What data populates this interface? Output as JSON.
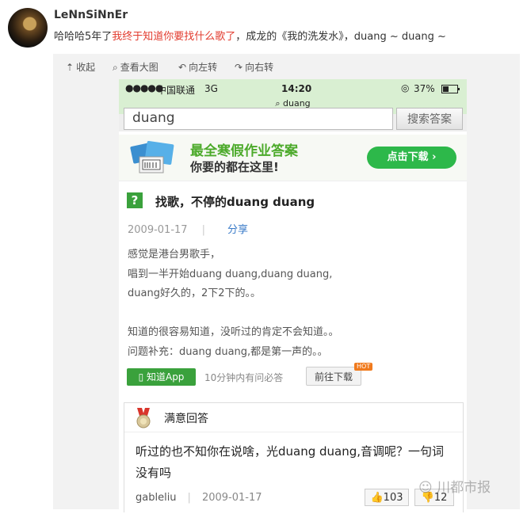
{
  "post": {
    "username": "LeNnSiNnEr",
    "text_before": "哈哈哈5年了",
    "text_highlight": "我终于知道你要找什么歌了",
    "text_after": "，成龙的《我的洗发水》，duang ~ duang ~"
  },
  "toolbar": {
    "collapse": "收起",
    "view_large": "查看大图",
    "rotate_left": "向左转",
    "rotate_right": "向右转"
  },
  "phone": {
    "status": {
      "signal": "●●●●●",
      "carrier": "中国联通",
      "network": "3G",
      "time": "14:20",
      "battery": "37%",
      "url": "duang"
    },
    "search": {
      "query": "duang",
      "button": "搜索答案"
    },
    "banner": {
      "line1": "最全寒假作业答案",
      "line2": "你要的都在这里!",
      "download": "点击下载 ›"
    },
    "question": {
      "icon": "?",
      "title": "找歌，不停的duang duang",
      "date": "2009-01-17",
      "share": "分享",
      "lines": [
        "感觉是港台男歌手，",
        "唱到一半开始duang duang,duang duang,",
        "duang好久的，2下2下的。。",
        "",
        "知道的很容易知道，没听过的肯定不会知道。。",
        "问题补充：duang duang,都是第一声的。。"
      ],
      "app_badge": "知道App",
      "app_text": "10分钟内有问必答",
      "go_download": "前往下载",
      "hot": "HOT"
    },
    "answer": {
      "header": "满意回答",
      "text": "听过的也不知你在说啥，光duang duang,音调呢？一句词没有吗",
      "author": "gableliu",
      "date": "2009-01-17",
      "likes": "103",
      "dislikes": "12"
    }
  },
  "watermark": "川都市报"
}
